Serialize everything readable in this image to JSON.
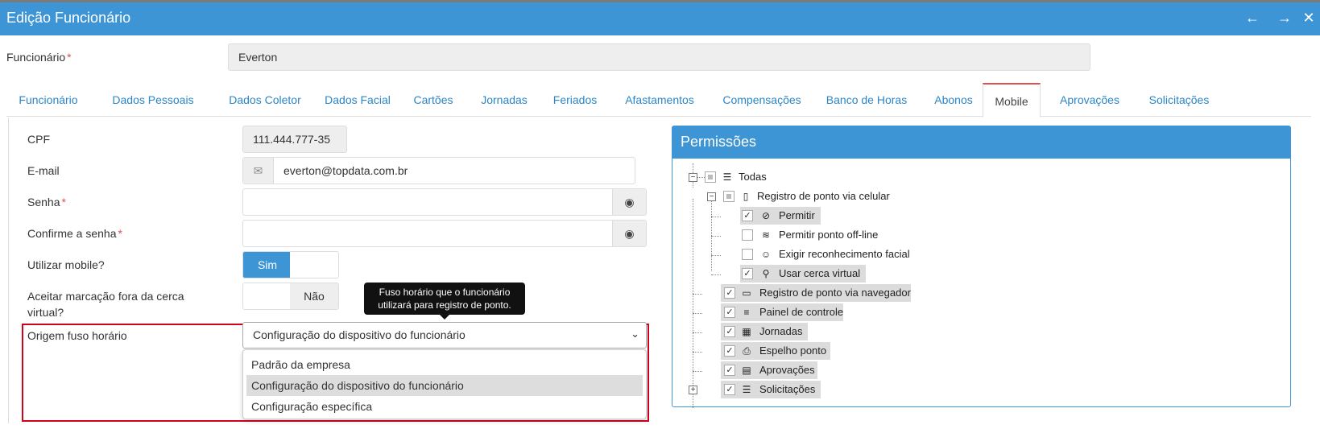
{
  "window": {
    "title": "Edição Funcionário",
    "back_icon": "←",
    "forward_icon": "→",
    "close_icon": "✕"
  },
  "employee": {
    "label": "Funcionário",
    "required_mark": "*",
    "value": "Everton"
  },
  "tabs": [
    {
      "label": "Funcionário"
    },
    {
      "label": "Dados Pessoais"
    },
    {
      "label": "Dados Coletor"
    },
    {
      "label": "Dados Facial"
    },
    {
      "label": "Cartões"
    },
    {
      "label": "Jornadas"
    },
    {
      "label": "Feriados"
    },
    {
      "label": "Afastamentos"
    },
    {
      "label": "Compensações"
    },
    {
      "label": "Banco de Horas"
    },
    {
      "label": "Abonos"
    },
    {
      "label": "Mobile"
    },
    {
      "label": "Aprovações"
    },
    {
      "label": "Solicitações"
    }
  ],
  "form": {
    "cpf_label": "CPF",
    "cpf_value": "111.444.777-35",
    "email_label": "E-mail",
    "email_value": "everton@topdata.com.br",
    "password_label": "Senha",
    "password_value": "",
    "confirm_label": "Confirme a senha",
    "confirm_value": "",
    "required_mark": "*",
    "use_mobile_label": "Utilizar mobile?",
    "use_mobile_on": "Sim",
    "accept_fence_label": "Aceitar marcação fora da cerca virtual?",
    "accept_fence_off": "Não",
    "timezone_label": "Origem fuso horário",
    "timezone_selected": "Configuração do dispositivo do funcionário",
    "timezone_options": [
      "Padrão da empresa",
      "Configuração do dispositivo do funcionário",
      "Configuração específica"
    ],
    "tooltip": "Fuso horário que o funcionário utilizará para registro de ponto."
  },
  "permissions": {
    "title": "Permissões",
    "tree": [
      {
        "label": "Todas",
        "icon": "list-icon",
        "state": "partial"
      },
      {
        "label": "Registro de ponto via celular",
        "icon": "mobile-icon",
        "state": "partial"
      },
      {
        "label": "Permitir",
        "icon": "check-circle-icon",
        "state": "checked"
      },
      {
        "label": "Permitir ponto off-line",
        "icon": "wifi-icon",
        "state": "unchecked"
      },
      {
        "label": "Exigir reconhecimento facial",
        "icon": "smile-icon",
        "state": "unchecked"
      },
      {
        "label": "Usar cerca virtual",
        "icon": "map-marker-icon",
        "state": "checked"
      },
      {
        "label": "Registro de ponto via navegador",
        "icon": "desktop-icon",
        "state": "checked"
      },
      {
        "label": "Painel de controle",
        "icon": "bars-icon",
        "state": "checked"
      },
      {
        "label": "Jornadas",
        "icon": "calendar-icon",
        "state": "checked"
      },
      {
        "label": "Espelho ponto",
        "icon": "print-icon",
        "state": "checked"
      },
      {
        "label": "Aprovações",
        "icon": "file-icon",
        "state": "checked"
      },
      {
        "label": "Solicitações",
        "icon": "list-icon",
        "state": "checked"
      }
    ]
  }
}
